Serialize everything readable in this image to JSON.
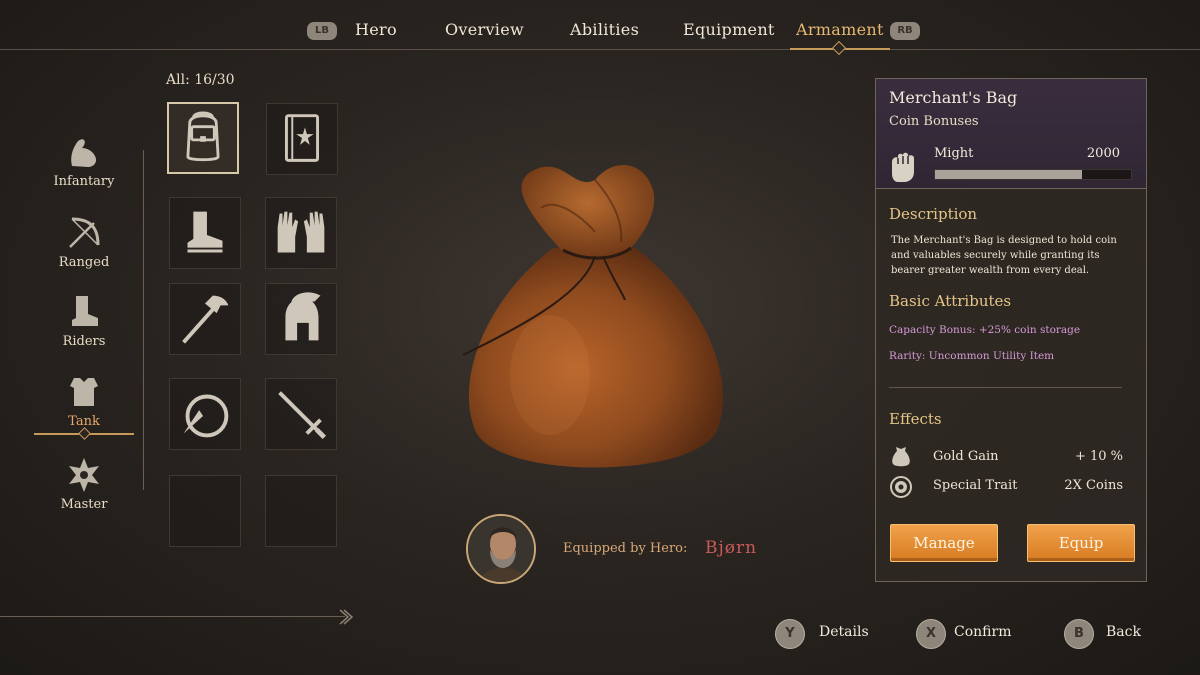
{
  "tabs": {
    "left_bumper": "LB",
    "right_bumper": "RB",
    "items": [
      "Hero",
      "Overview",
      "Abilities",
      "Equipment",
      "Armament"
    ],
    "active": "Armament"
  },
  "classes": {
    "items": [
      "Infantary",
      "Ranged",
      "Riders",
      "Tank",
      "Master"
    ],
    "active": "Tank"
  },
  "inventory": {
    "count_label": "All: 16/30",
    "slots": [
      "backpack-icon",
      "book-icon",
      "boot-icon",
      "gloves-icon",
      "hammer-icon",
      "helmet-icon",
      "ring-icon",
      "sword-icon",
      "empty",
      "empty"
    ],
    "selected_index": 0
  },
  "preview": {
    "item_icon": "coin-bag-icon",
    "equipped_label": "Equipped by Hero:",
    "hero_name": "Bjørn"
  },
  "details": {
    "title": "Merchant's Bag",
    "subtitle": "Coin Bonuses",
    "stat_label": "Might",
    "stat_value": "2000",
    "stat_fill_fraction": 0.75,
    "description_heading": "Description",
    "description": "The Merchant's Bag is designed to hold coin and valuables securely while granting its bearer greater wealth from every deal.",
    "attributes_heading": "Basic Attributes",
    "attributes": [
      "Capacity Bonus: +25% coin storage",
      "Rarity: Uncommon Utility Item"
    ],
    "effects_heading": "Effects",
    "effects": [
      {
        "icon": "coin-bag-icon",
        "label": "Gold Gain",
        "value": "+ 10 %"
      },
      {
        "icon": "coin-icon",
        "label": "Special Trait",
        "value": "2X Coins"
      }
    ],
    "manage_label": "Manage",
    "equip_label": "Equip"
  },
  "prompts": [
    {
      "key": "Y",
      "label": "Details"
    },
    {
      "key": "X",
      "label": "Confirm"
    },
    {
      "key": "B",
      "label": "Back"
    }
  ],
  "colors": {
    "accent_gold": "#c89a5a",
    "active_tab": "#e6b872",
    "button_orange": "#e08a2e",
    "hero_name": "#c95a5a",
    "attribute_text": "#d69ad8",
    "header_purple": "#3a2e3e"
  }
}
